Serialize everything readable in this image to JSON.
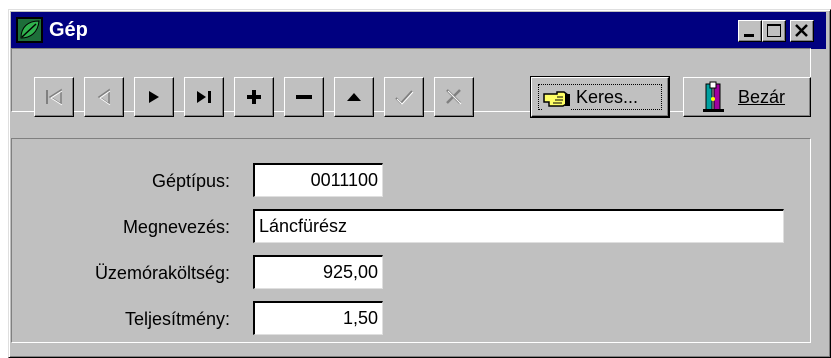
{
  "window": {
    "title": "Gép"
  },
  "toolbar": {
    "nav_buttons": [
      {
        "name": "first",
        "icon": "first-record-icon",
        "enabled": false
      },
      {
        "name": "prior",
        "icon": "prior-record-icon",
        "enabled": false
      },
      {
        "name": "next",
        "icon": "next-record-icon",
        "enabled": true
      },
      {
        "name": "last",
        "icon": "last-record-icon",
        "enabled": true
      },
      {
        "name": "insert",
        "icon": "plus-icon",
        "enabled": true
      },
      {
        "name": "delete",
        "icon": "minus-icon",
        "enabled": true
      },
      {
        "name": "edit",
        "icon": "up-triangle-icon",
        "enabled": true
      },
      {
        "name": "post",
        "icon": "checkmark-icon",
        "enabled": false
      },
      {
        "name": "cancel",
        "icon": "x-mark-icon",
        "enabled": false
      }
    ],
    "search_label": "Keres...",
    "close_label": "Bezár"
  },
  "form": {
    "geptipus": {
      "label": "Géptípus:",
      "value": "0011100"
    },
    "megnevezes": {
      "label": "Megnevezés:",
      "value": "Láncfürész"
    },
    "uzemorakoltseg": {
      "label": "Üzemóraköltség:",
      "value": "925,00"
    },
    "teljesitmeny": {
      "label": "Teljesítmény:",
      "value": "1,50"
    }
  },
  "colors": {
    "titlebar": "#000080",
    "face": "#c0c0c0",
    "disabled_glyph": "#808080"
  }
}
